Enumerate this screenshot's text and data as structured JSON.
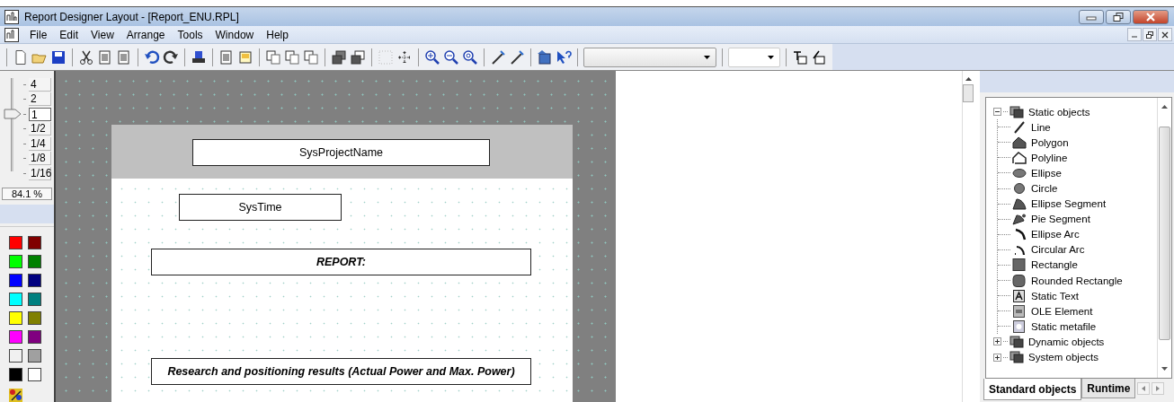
{
  "window": {
    "title": "Report Designer Layout - [Report_ENU.RPL]"
  },
  "menu": [
    "File",
    "Edit",
    "View",
    "Arrange",
    "Tools",
    "Window",
    "Help"
  ],
  "zoom": {
    "levels": [
      {
        "label": "4",
        "selected": false
      },
      {
        "label": "2",
        "selected": false
      },
      {
        "label": "1",
        "selected": true
      },
      {
        "label": "1/2",
        "selected": false
      },
      {
        "label": "1/4",
        "selected": false
      },
      {
        "label": "1/8",
        "selected": false
      },
      {
        "label": "1/16",
        "selected": false
      }
    ],
    "reading": "84.1 %"
  },
  "palette": [
    {
      "color": "#ff0000"
    },
    {
      "color": "#800000"
    },
    {
      "color": "#00ff00"
    },
    {
      "color": "#008000"
    },
    {
      "color": "#0000ff"
    },
    {
      "color": "#000080"
    },
    {
      "color": "#00ffff"
    },
    {
      "color": "#008080"
    },
    {
      "color": "#ffff00"
    },
    {
      "color": "#808000"
    },
    {
      "color": "#ff00ff"
    },
    {
      "color": "#800080"
    },
    {
      "color": "#f0f0f0"
    },
    {
      "color": "#a0a0a0"
    },
    {
      "color": "#000000"
    },
    {
      "color": "#ffffff"
    }
  ],
  "report_objects": [
    {
      "text": "SysProjectName",
      "kind": "plain"
    },
    {
      "text": "SysTime",
      "kind": "plain"
    },
    {
      "text": "REPORT:",
      "kind": "emphasis"
    },
    {
      "text": "Research and positioning results (Actual Power and Max. Power)",
      "kind": "emphasis"
    }
  ],
  "object_tree": [
    {
      "label": "Static objects",
      "expanded": true,
      "children": [
        {
          "label": "Line",
          "kind": "line"
        },
        {
          "label": "Polygon",
          "kind": "polygon"
        },
        {
          "label": "Polyline",
          "kind": "polyline"
        },
        {
          "label": "Ellipse",
          "kind": "ellipse"
        },
        {
          "label": "Circle",
          "kind": "circle"
        },
        {
          "label": "Ellipse Segment",
          "kind": "segment"
        },
        {
          "label": "Pie Segment",
          "kind": "pie"
        },
        {
          "label": "Ellipse Arc",
          "kind": "arc"
        },
        {
          "label": "Circular Arc",
          "kind": "circarc"
        },
        {
          "label": "Rectangle",
          "kind": "rect"
        },
        {
          "label": "Rounded Rectangle",
          "kind": "rrect"
        },
        {
          "label": "Static Text",
          "kind": "text"
        },
        {
          "label": "OLE Element",
          "kind": "ole"
        },
        {
          "label": "Static metafile",
          "kind": "meta"
        }
      ]
    },
    {
      "label": "Dynamic objects",
      "expanded": false
    },
    {
      "label": "System objects",
      "expanded": false
    }
  ],
  "tabs": [
    {
      "label": "Standard objects",
      "selected": true
    },
    {
      "label": "Runtime",
      "selected": false
    }
  ]
}
